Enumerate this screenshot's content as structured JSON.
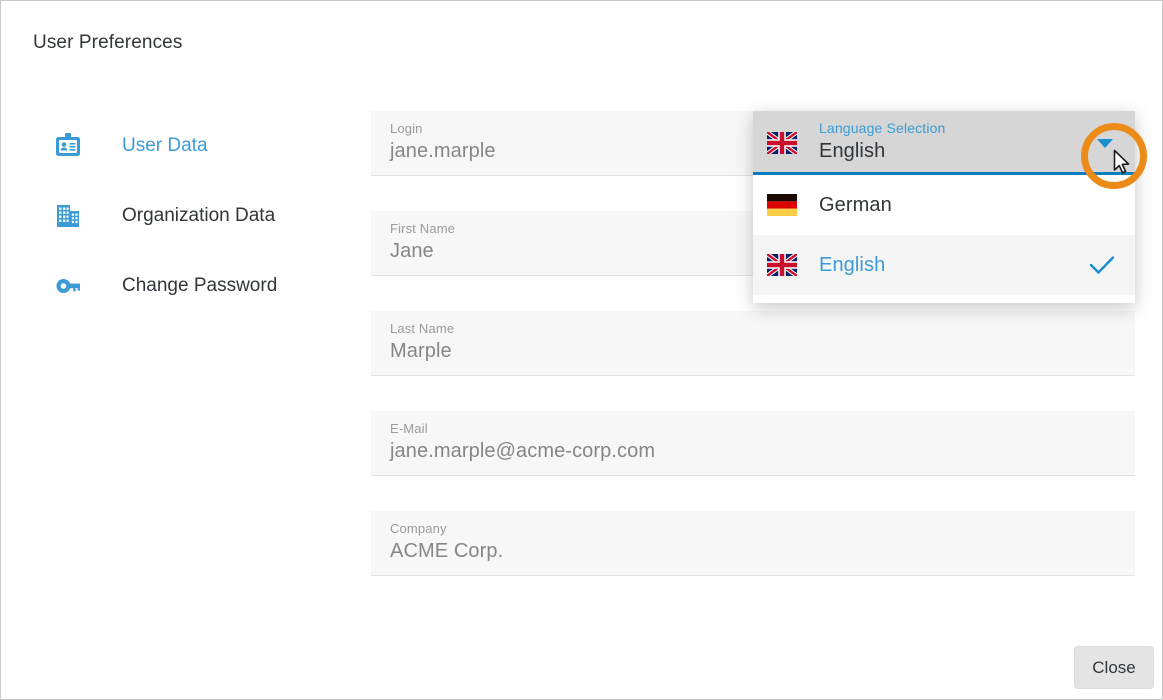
{
  "page": {
    "title": "User Preferences"
  },
  "sidebar": {
    "items": [
      {
        "label": "User Data",
        "icon": "id-badge-icon",
        "active": true
      },
      {
        "label": "Organization Data",
        "icon": "building-icon",
        "active": false
      },
      {
        "label": "Change Password",
        "icon": "key-icon",
        "active": false
      }
    ]
  },
  "form": {
    "fields": [
      {
        "label": "Login",
        "value": "jane.marple"
      },
      {
        "label": "First Name",
        "value": "Jane"
      },
      {
        "label": "Last Name",
        "value": "Marple"
      },
      {
        "label": "E-Mail",
        "value": "jane.marple@acme-corp.com"
      },
      {
        "label": "Company",
        "value": "ACME Corp."
      }
    ]
  },
  "language_selector": {
    "label": "Language Selection",
    "value": "English",
    "flag": "uk-flag-icon",
    "expanded": true,
    "options": [
      {
        "label": "German",
        "flag": "german-flag-icon",
        "selected": false
      },
      {
        "label": "English",
        "flag": "uk-flag-icon",
        "selected": true
      }
    ]
  },
  "footer": {
    "close_label": "Close"
  },
  "colors": {
    "accent_blue": "#3b9bd6",
    "underline_blue": "#0a7cc0",
    "highlight_orange": "#ec8b18",
    "text_dark": "#32363a",
    "field_bg": "#f7f7f7",
    "header_bg": "#d6d6d6"
  }
}
